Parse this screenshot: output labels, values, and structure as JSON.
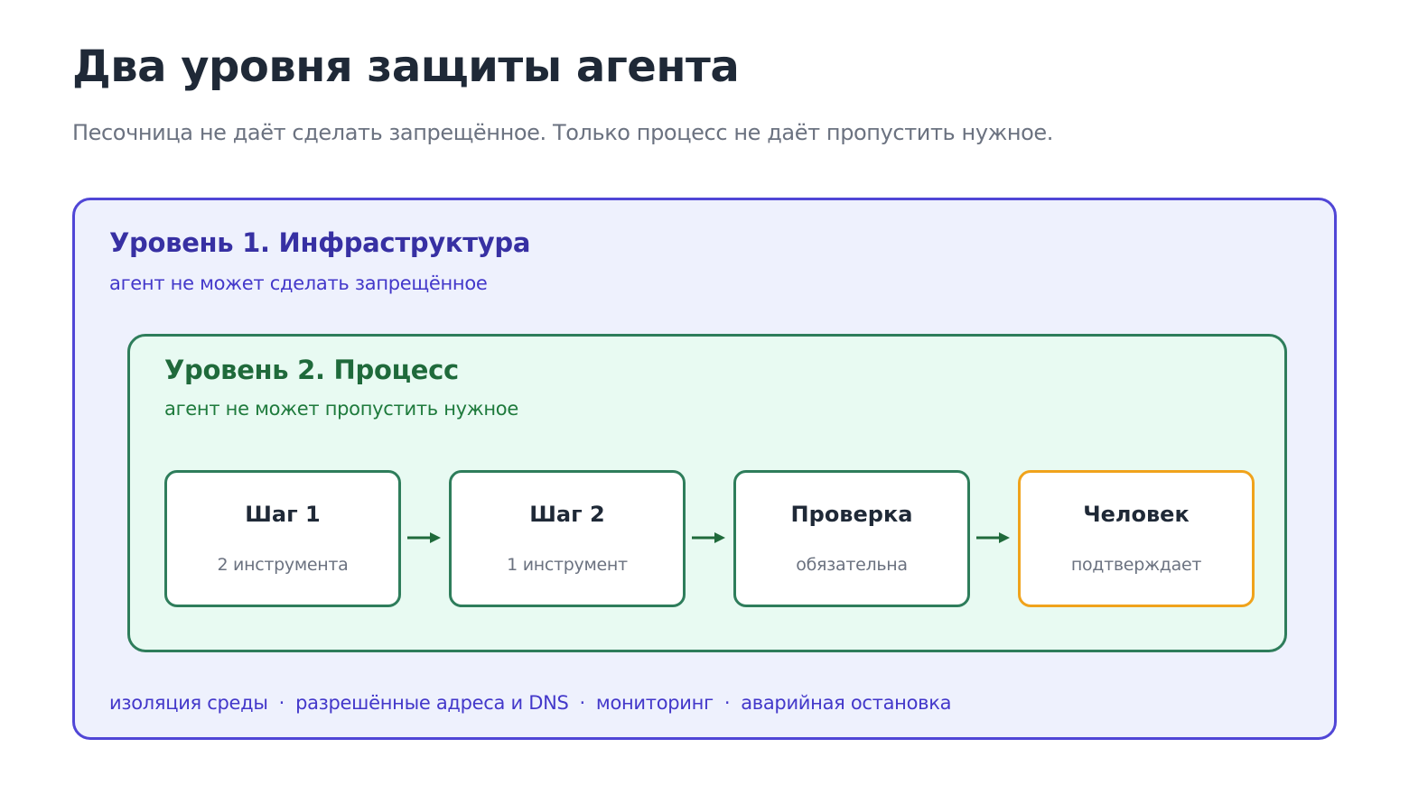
{
  "header": {
    "title": "Два уровня защиты агента",
    "subtitle": "Песочница не даёт сделать запрещённое. Только процесс не даёт пропустить нужное."
  },
  "level1": {
    "title": "Уровень 1. Инфраструктура",
    "caption": "агент не может сделать запрещённое",
    "features": [
      "изоляция среды",
      "разрешённые адреса и DNS",
      "мониторинг",
      "аварийная остановка"
    ],
    "separator": "·"
  },
  "level2": {
    "title": "Уровень 2. Процесс",
    "caption": "агент не может пропустить нужное",
    "steps": [
      {
        "title": "Шаг 1",
        "subtitle": "2 инструмента"
      },
      {
        "title": "Шаг 2",
        "subtitle": "1 инструмент"
      },
      {
        "title": "Проверка",
        "subtitle": "обязательна"
      },
      {
        "title": "Человек",
        "subtitle": "подтверждает"
      }
    ]
  },
  "colors": {
    "level1_border": "#5046d6",
    "level1_fill": "#eef1fd",
    "level2_border": "#2e7d5b",
    "level2_fill": "#e8faf2",
    "human_border": "#f0a31c",
    "arrow": "#1f6a3b"
  }
}
